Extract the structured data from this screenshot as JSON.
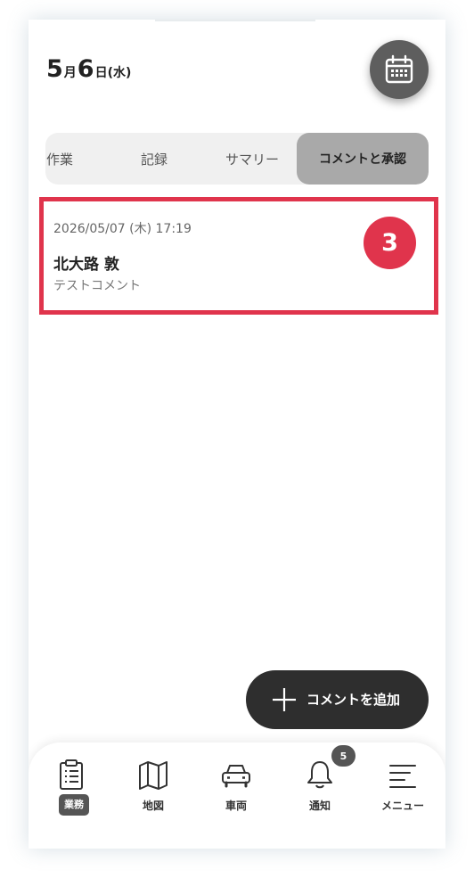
{
  "header": {
    "date_month": "5",
    "date_month_suffix": "月",
    "date_day": "6",
    "date_day_suffix": "日(水)",
    "calendar_icon": "calendar-icon"
  },
  "tabs": [
    {
      "label": "作業",
      "active": false
    },
    {
      "label": "記録",
      "active": false
    },
    {
      "label": "サマリー",
      "active": false
    },
    {
      "label": "コメントと承認",
      "active": true
    }
  ],
  "comments": [
    {
      "datetime": "2026/05/07 (木) 17:19",
      "author": "北大路 敦",
      "text": "テストコメント",
      "badge": "3"
    }
  ],
  "fab": {
    "label": "コメントを追加",
    "icon": "plus-icon"
  },
  "nav": {
    "items": [
      {
        "label": "業務",
        "icon": "clipboard-icon",
        "active": true
      },
      {
        "label": "地図",
        "icon": "map-icon",
        "active": false
      },
      {
        "label": "車両",
        "icon": "car-icon",
        "active": false
      },
      {
        "label": "通知",
        "icon": "bell-icon",
        "active": false
      },
      {
        "label": "メニュー",
        "icon": "menu-icon",
        "active": false
      }
    ],
    "notification_count": "5"
  },
  "colors": {
    "accent_red": "#e0344c",
    "dark": "#2e2e2e",
    "tab_active_bg": "#a9a9a9",
    "tab_bg": "#f0f0f0"
  }
}
